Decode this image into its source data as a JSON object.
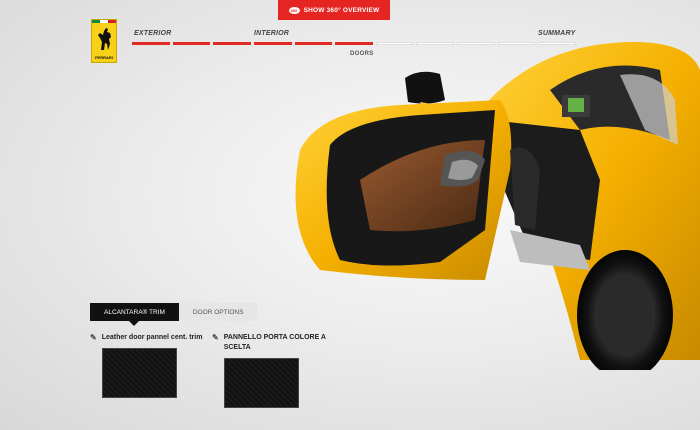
{
  "header": {
    "overview_button": "SHOW 360° OVERVIEW",
    "overview_icon": "360-icon",
    "logo_text": "FERRARI"
  },
  "steps": {
    "exterior": "EXTERIOR",
    "interior": "INTERIOR",
    "summary": "SUMMARY",
    "current_sub": "DOORS",
    "segments_total": 11,
    "segments_done": 6
  },
  "colors": {
    "accent": "#e52521",
    "car_yellow": "#f5b800",
    "interior_tan": "#7a4423"
  },
  "panel": {
    "tabs": [
      {
        "label": "ALCANTARA® TRIM",
        "active": true
      },
      {
        "label": "DOOR OPTIONS",
        "active": false
      }
    ],
    "options": [
      {
        "label": "Leather door pannel cent. trim",
        "icon": "pencil-icon"
      },
      {
        "label": "PANNELLO PORTA COLORE A SCELTA",
        "icon": "pencil-icon"
      }
    ]
  }
}
